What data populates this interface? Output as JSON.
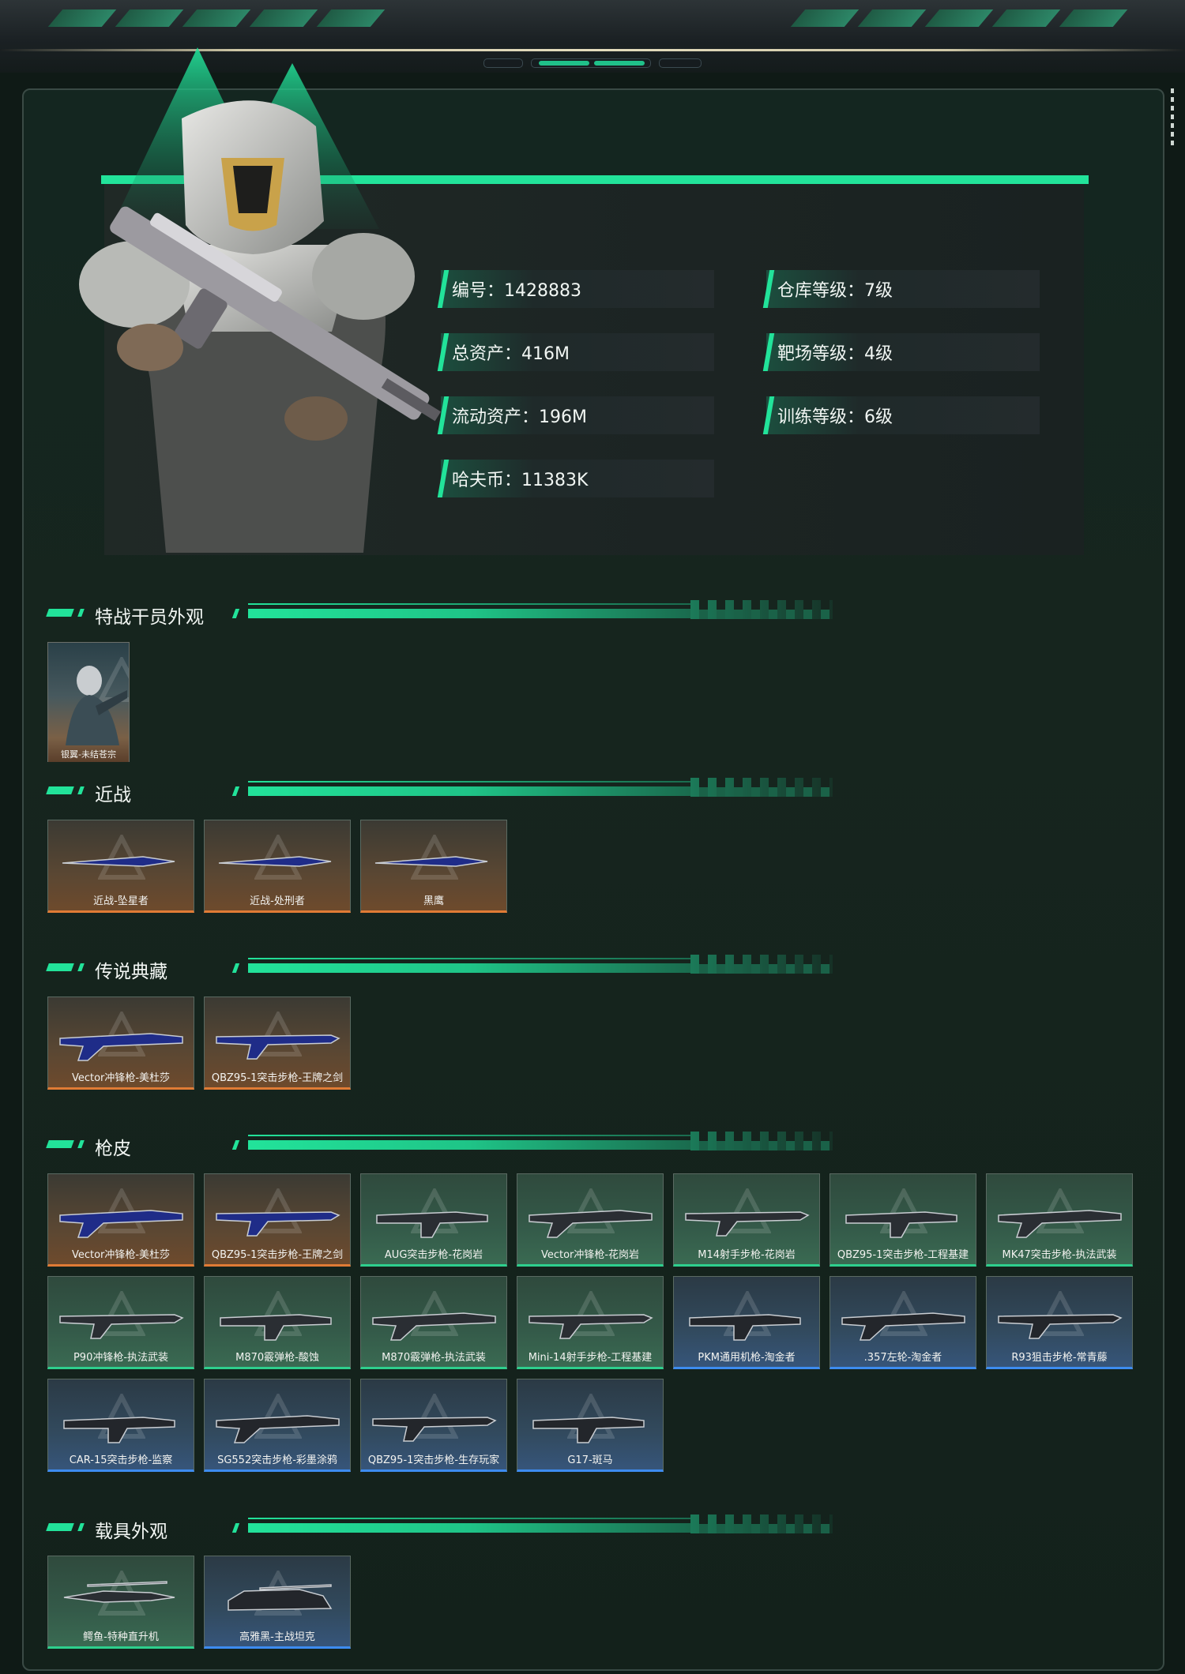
{
  "stats": {
    "id": "编号：1428883",
    "warehouse_level": "仓库等级：7级",
    "total_assets": "总资产：416M",
    "range_level": "靶场等级：4级",
    "liquid_assets": "流动资产：196M",
    "training_level": "训练等级：6级",
    "havoc_coins": "哈夫币：11383K"
  },
  "sections": {
    "operator": {
      "title": "特战干员外观",
      "items": [
        {
          "label": "银翼-未结苍宗",
          "rarity": "orange"
        }
      ]
    },
    "melee": {
      "title": "近战",
      "items": [
        {
          "label": "近战-坠星者",
          "rarity": "orange"
        },
        {
          "label": "近战-处刑者",
          "rarity": "orange"
        },
        {
          "label": "黑鹰",
          "rarity": "orange"
        }
      ]
    },
    "legendary": {
      "title": "传说典藏",
      "items": [
        {
          "label": "Vector冲锋枪-美杜莎",
          "rarity": "orange"
        },
        {
          "label": "QBZ95-1突击步枪-王牌之剑",
          "rarity": "orange"
        }
      ]
    },
    "gun_skins": {
      "title": "枪皮",
      "items": [
        {
          "label": "Vector冲锋枪-美杜莎",
          "rarity": "orange"
        },
        {
          "label": "QBZ95-1突击步枪-王牌之剑",
          "rarity": "orange"
        },
        {
          "label": "AUG突击步枪-花岗岩",
          "rarity": "green"
        },
        {
          "label": "Vector冲锋枪-花岗岩",
          "rarity": "green"
        },
        {
          "label": "M14射手步枪-花岗岩",
          "rarity": "green"
        },
        {
          "label": "QBZ95-1突击步枪-工程基建",
          "rarity": "green"
        },
        {
          "label": "MK47突击步枪-执法武装",
          "rarity": "green"
        },
        {
          "label": "P90冲锋枪-执法武装",
          "rarity": "green"
        },
        {
          "label": "M870霰弹枪-酸蚀",
          "rarity": "green"
        },
        {
          "label": "M870霰弹枪-执法武装",
          "rarity": "green"
        },
        {
          "label": "Mini-14射手步枪-工程基建",
          "rarity": "green"
        },
        {
          "label": "PKM通用机枪-淘金者",
          "rarity": "blue"
        },
        {
          "label": ".357左轮-淘金者",
          "rarity": "blue"
        },
        {
          "label": "R93狙击步枪-常青藤",
          "rarity": "blue"
        },
        {
          "label": "CAR-15突击步枪-监察",
          "rarity": "blue"
        },
        {
          "label": "SG552突击步枪-彩墨涂鸦",
          "rarity": "blue"
        },
        {
          "label": "QBZ95-1突击步枪-生存玩家",
          "rarity": "blue"
        },
        {
          "label": "G17-斑马",
          "rarity": "blue"
        }
      ]
    },
    "vehicles": {
      "title": "载具外观",
      "items": [
        {
          "label": "鳄鱼-特种直升机",
          "rarity": "green"
        },
        {
          "label": "高雅黑-主战坦克",
          "rarity": "blue"
        }
      ]
    }
  },
  "colors": {
    "accent": "#22e39a",
    "orange": "#e07b35",
    "green": "#2ecf8d",
    "blue": "#3d8cf0"
  }
}
